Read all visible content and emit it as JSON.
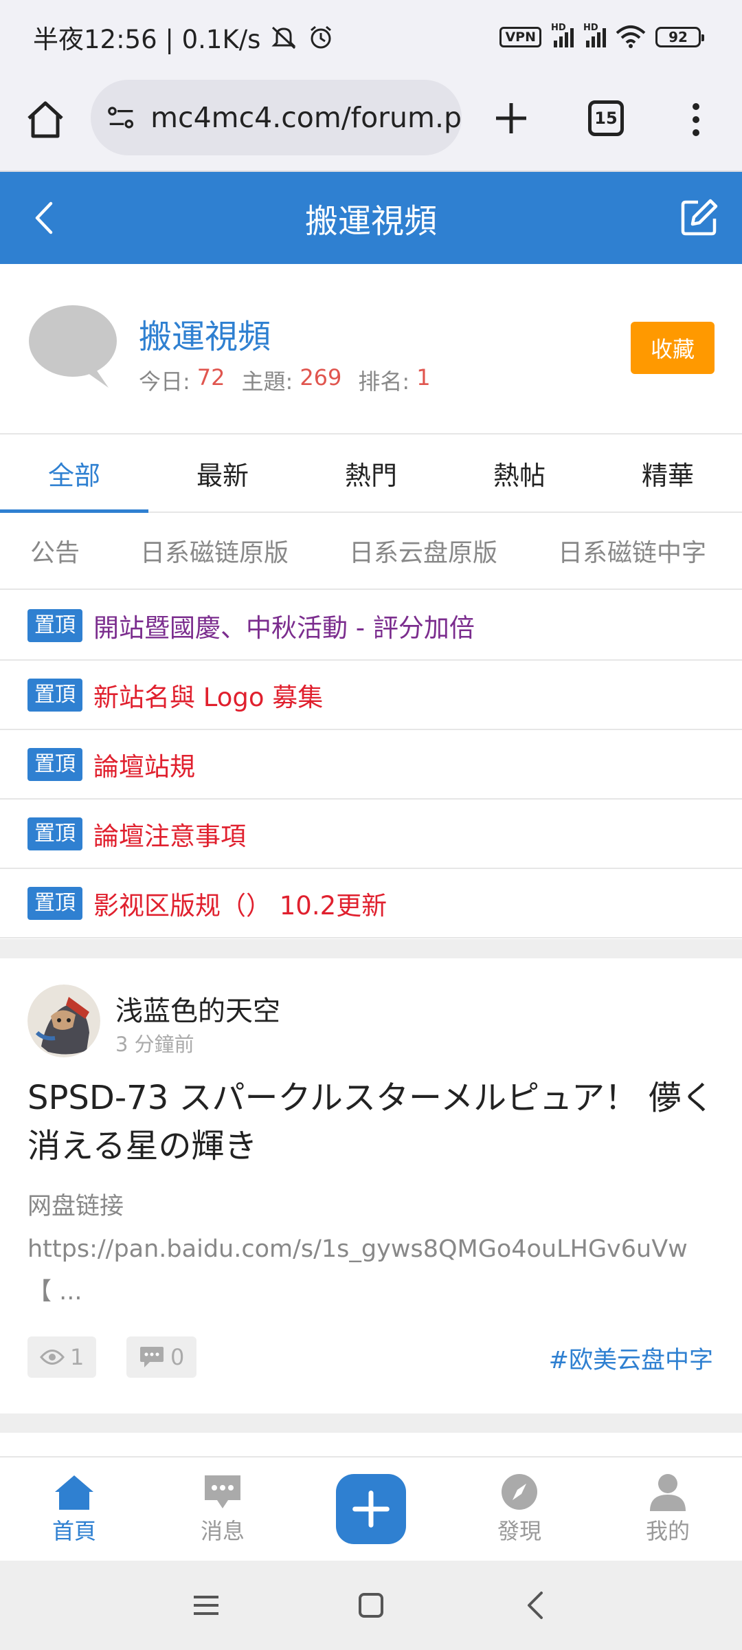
{
  "status_bar": {
    "time_text": "半夜12:56 | 0.1K/s",
    "vpn": "VPN",
    "hd1": "HD",
    "hd2": "HD",
    "battery": "92"
  },
  "browser": {
    "url": "mc4mc4.com/forum.p",
    "tab_count": "15"
  },
  "forum_header": {
    "title": "搬運視頻"
  },
  "forum_info": {
    "name": "搬運視頻",
    "today_label": "今日:",
    "today_value": "72",
    "topics_label": "主題:",
    "topics_value": "269",
    "rank_label": "排名:",
    "rank_value": "1",
    "favorite_label": "收藏"
  },
  "main_tabs": [
    "全部",
    "最新",
    "熱門",
    "熱帖",
    "精華"
  ],
  "sub_tabs": [
    "公告",
    "日系磁链原版",
    "日系云盘原版",
    "日系磁链中字"
  ],
  "sticky_threads": [
    {
      "badge": "置頂",
      "title": "開站暨國慶、中秋活動 - 評分加倍",
      "color": "#7b2d8e"
    },
    {
      "badge": "置頂",
      "title": "新站名與 Logo 募集",
      "color": "#e0202e"
    },
    {
      "badge": "置頂",
      "title": "論壇站規",
      "color": "#e0202e"
    },
    {
      "badge": "置頂",
      "title": "論壇注意事項",
      "color": "#e0202e"
    },
    {
      "badge": "置頂",
      "title": "影视区版规（） 10.2更新",
      "color": "#e0202e"
    }
  ],
  "post": {
    "author": "浅蓝色的天空",
    "time": "3 分鐘前",
    "title": "SPSD-73 スパークルスターメルピュア！ 儚く消える星の輝き",
    "excerpt_line1": "网盘链接",
    "excerpt_line2": "https://pan.baidu.com/s/1s_gyws8QMGo4ouLHGv6uVw",
    "excerpt_line3": "【 ...",
    "views": "1",
    "replies": "0",
    "tag": "#欧美云盘中字"
  },
  "bottom_nav": {
    "home": "首頁",
    "messages": "消息",
    "discover": "發現",
    "mine": "我的"
  },
  "colors": {
    "primary": "#2f80d1",
    "favorite": "#ff9900",
    "stat_number": "#e0554e"
  }
}
